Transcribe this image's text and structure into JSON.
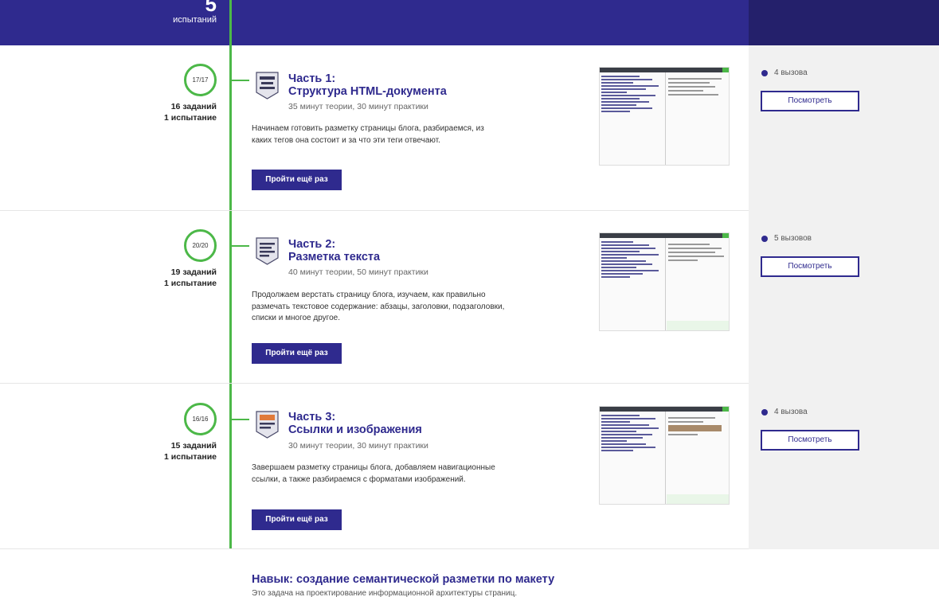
{
  "header": {
    "tests_count": "5",
    "tests_label": "испытаний"
  },
  "parts": [
    {
      "progress": "17/17",
      "tasks": "16 заданий",
      "tests": "1 испытание",
      "title_line1": "Часть 1:",
      "title_line2": "Структура HTML-документа",
      "meta": "35 минут теории, 30 минут практики",
      "desc": "Начинаем готовить разметку страницы блога, разбираемся, из каких тегов она состоит и за что эти теги отвечают.",
      "button": "Пройти ещё раз",
      "calls": "4 вызова",
      "view_button": "Посмотреть",
      "icon": "html-document-icon"
    },
    {
      "progress": "20/20",
      "tasks": "19 заданий",
      "tests": "1 испытание",
      "title_line1": "Часть 2:",
      "title_line2": "Разметка текста",
      "meta": "40 минут теории, 50 минут практики",
      "desc": "Продолжаем верстать страницу блога, изучаем, как правильно размечать текстовое содержание: абзацы, заголовки, подзаголовки, списки и многое другое.",
      "button": "Пройти ещё раз",
      "calls": "5 вызовов",
      "view_button": "Посмотреть",
      "icon": "text-markup-icon"
    },
    {
      "progress": "16/16",
      "tasks": "15 заданий",
      "tests": "1 испытание",
      "title_line1": "Часть 3:",
      "title_line2": "Ссылки и изображения",
      "meta": "30 минут теории, 30 минут практики",
      "desc": "Завершаем разметку страницы блога, добавляем навигационные ссылки, а также разбираемся с форматами изображений.",
      "button": "Пройти ещё раз",
      "calls": "4 вызова",
      "view_button": "Посмотреть",
      "icon": "links-images-icon"
    }
  ],
  "skill": {
    "title": "Навык: создание семантической разметки по макету",
    "desc": "Это задача на проектирование информационной архитектуры страниц."
  },
  "colors": {
    "accent": "#2f2a8e",
    "progress": "#4cb848",
    "side": "#f1f1f1"
  }
}
